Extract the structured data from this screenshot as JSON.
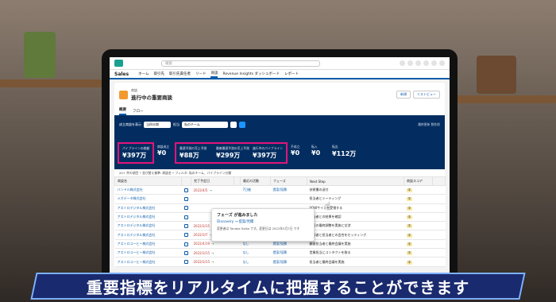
{
  "header": {
    "app_name": "Sales",
    "search_placeholder": "検索"
  },
  "nav": [
    "ホーム",
    "取引先",
    "取引先責任者",
    "リード",
    "商談",
    "Revenue Insights ダッシュボード",
    "レポート"
  ],
  "list_view": {
    "object_label": "商談",
    "title": "進行中の重要商談",
    "buttons": [
      "新規",
      "リストビュー"
    ]
  },
  "tabs": [
    "概要",
    "フロー"
  ],
  "filters": {
    "label1": "成立商談を表示",
    "value1": "当四半期",
    "label2": "担当",
    "value2": "私のチーム"
  },
  "last_updated": "最終更新 数秒前",
  "kpis": [
    {
      "label": "パイプラインの総額",
      "value": "¥397万",
      "boxed": true
    },
    {
      "label": "商談成立",
      "value": "¥0",
      "boxed": false
    },
    {
      "label": "最適予測の売上予測",
      "value": "¥88万",
      "boxed": true
    },
    {
      "label": "最善最適予測の売上予測",
      "value": "¥299万",
      "boxed": true
    },
    {
      "label": "進行中のパイプライン",
      "value": "¥397万",
      "boxed": true
    },
    {
      "label": "不成立",
      "value": "¥0",
      "boxed": false
    },
    {
      "label": "転入",
      "value": "¥0",
      "boxed": false
    },
    {
      "label": "転出",
      "value": "¥112万",
      "boxed": false
    }
  ],
  "list_info": "20+ 件の項目 • 並び替え基準: 商談名 • フィルタ: 私のチーム、パイプライン分類",
  "columns": [
    "商談名",
    "",
    "完了予定日",
    "",
    "最近の活動",
    "フェーズ",
    "Next Step",
    "商談スコア",
    ""
  ],
  "rows": [
    {
      "name": "バンドル株式会社",
      "date": "2022/4/5",
      "activity": "7日後",
      "phase": "提案/見積",
      "next": "技術書の送付",
      "score": "中"
    },
    {
      "name": "メガデータ株式会社",
      "date": "",
      "activity": "",
      "phase": "",
      "next": "担当者とミーティング",
      "score": "中"
    },
    {
      "name": "アストロデジタル株式会社",
      "date": "",
      "activity": "",
      "phase": "",
      "next": "SOWサインを受領する",
      "score": "中"
    },
    {
      "name": "アストロデジタル株式会社",
      "date": "",
      "activity": "",
      "phase": "",
      "next": "担当者との結果を確認",
      "score": "中"
    },
    {
      "name": "アストロデジタル株式会社",
      "date": "2022/3/15",
      "activity": "7日後",
      "phase": "交渉",
      "next": "技術の最終調整を実施と交渉",
      "score": "中"
    },
    {
      "name": "アストロデジタル株式会社",
      "date": "2022/3/7",
      "activity": "なし",
      "phase": "ディスカバリ",
      "next": "技術者と担当者との会合をセッティング",
      "score": "中"
    },
    {
      "name": "アストロコーヒー株式会社",
      "date": "2022/4/19",
      "activity": "なし",
      "phase": "提案/見積",
      "next": "顧客担当者と最終会議を実施",
      "score": "中"
    },
    {
      "name": "アストロコーヒー株式会社",
      "date": "2022/3/15",
      "activity": "なし",
      "phase": "提案/見積",
      "next": "営業担当にコンタクトを取る",
      "score": "中"
    },
    {
      "name": "アストロコーヒー株式会社",
      "date": "2022/3/15",
      "activity": "なし",
      "phase": "提案/見積",
      "next": "担当者と最終会議を実施",
      "score": "中"
    }
  ],
  "popover": {
    "title": "フェーズ が進みました",
    "phase_line": "Discovery → 提案/見積",
    "detail": "変更者は Tanaka Saiko です。変更日は 2022年3月7日 です"
  },
  "caption": "重要指標をリアルタイムに把握することができます",
  "colors": {
    "brand": "#0b5cab",
    "dashboard": "#032d60",
    "highlight": "#e2147a",
    "caption_bg": "#1a2a6e"
  }
}
